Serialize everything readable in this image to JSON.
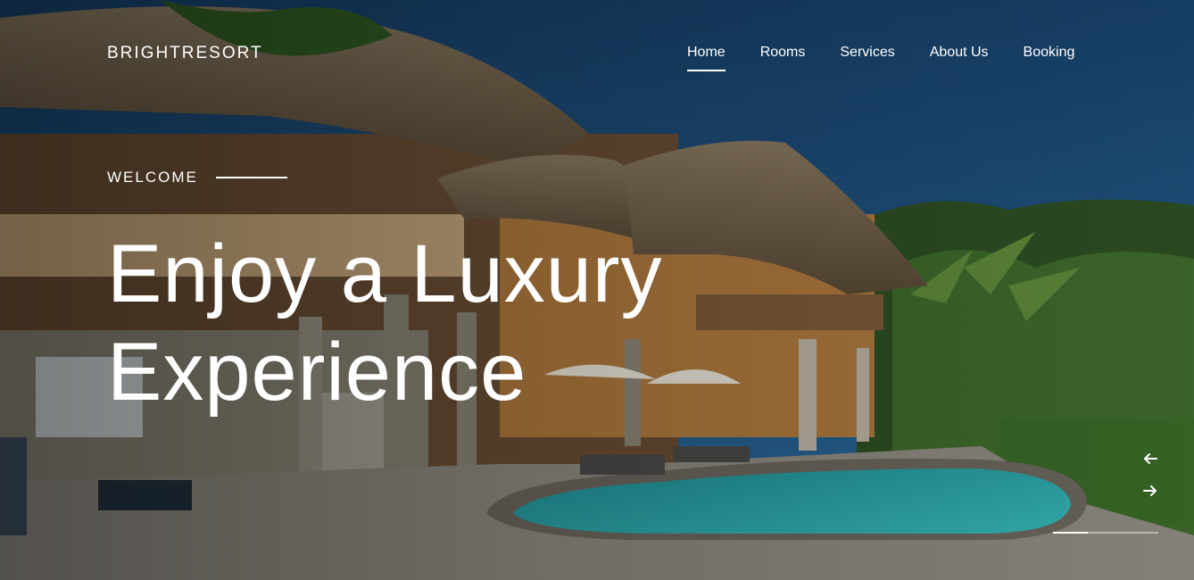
{
  "brand": {
    "name": "BRIGHTRESORT"
  },
  "nav": {
    "items": [
      {
        "label": "Home",
        "active": true
      },
      {
        "label": "Rooms",
        "active": false
      },
      {
        "label": "Services",
        "active": false
      },
      {
        "label": "About Us",
        "active": false
      },
      {
        "label": "Booking",
        "active": false
      }
    ]
  },
  "hero": {
    "eyebrow": "WELCOME",
    "headline_line1": "Enjoy a Luxury",
    "headline_line2": "Experience",
    "image": "tropical-resort-villa-with-pool"
  },
  "slider": {
    "prev_icon": "arrow-left-icon",
    "next_icon": "arrow-right-icon",
    "progress_fraction": 0.33
  },
  "colors": {
    "text": "#ffffff",
    "sky": "#1f4f7a",
    "pool": "#2aa3a6",
    "foliage": "#2e5a22",
    "thatch": "#a08f72"
  }
}
